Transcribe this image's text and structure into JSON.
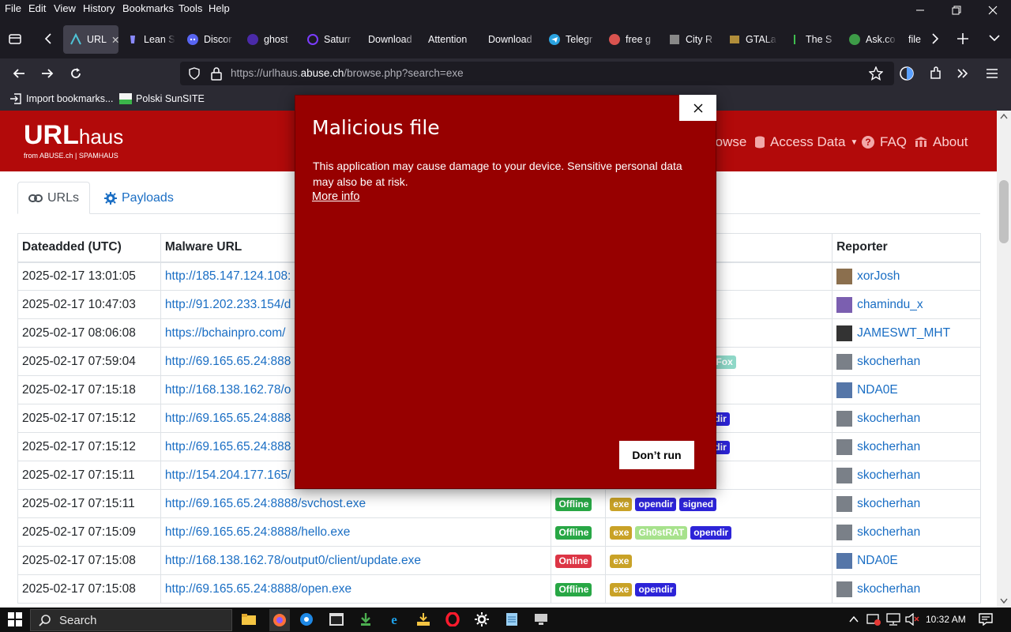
{
  "menu": {
    "items": [
      "File",
      "Edit",
      "View",
      "History",
      "Bookmarks",
      "Tools",
      "Help"
    ]
  },
  "tabs": [
    {
      "label": "URL",
      "active": true
    },
    {
      "label": "Lean S"
    },
    {
      "label": "Discor"
    },
    {
      "label": "ghost"
    },
    {
      "label": "Saturr"
    },
    {
      "label": "Download"
    },
    {
      "label": "Attention"
    },
    {
      "label": "Download"
    },
    {
      "label": "Telegr"
    },
    {
      "label": "free g"
    },
    {
      "label": "City R"
    },
    {
      "label": "GTALa"
    },
    {
      "label": "The S"
    },
    {
      "label": "Ask.co"
    },
    {
      "label": "file"
    }
  ],
  "navbar": {
    "url_prefix": "https://urlhaus.",
    "url_domain": "abuse.ch",
    "url_suffix": "/browse.php?search=exe"
  },
  "bookmarks": {
    "import": "Import bookmarks...",
    "sunsite": "Polski SunSITE"
  },
  "site": {
    "logo_main": "URL",
    "logo_sub": "haus",
    "logo_from": "from ABUSE.ch  |  SPAMHAUS",
    "nav": {
      "browse": "rowse",
      "access": "Access Data",
      "faq": "FAQ",
      "about": "About"
    },
    "tabs": {
      "urls": "URLs",
      "payloads": "Payloads"
    }
  },
  "table": {
    "headers": {
      "date": "Dateadded (UTC)",
      "url": "Malware URL",
      "reporter": "Reporter"
    },
    "rows": [
      {
        "date": "2025-02-17 13:01:05",
        "url": "http://185.147.124.108:",
        "status": "",
        "tags": [],
        "reporter": "xorJosh"
      },
      {
        "date": "2025-02-17 10:47:03",
        "url": "http://91.202.233.154/d",
        "status": "",
        "tags": [],
        "reporter": "chamindu_x"
      },
      {
        "date": "2025-02-17 08:06:08",
        "url": "https://bchainpro.com/",
        "status": "",
        "tags": [],
        "reporter": "JAMESWT_MHT"
      },
      {
        "date": "2025-02-17 07:59:04",
        "url": "http://69.165.65.24:888",
        "status": "",
        "tags": [
          "Fox"
        ],
        "reporter": "skocherhan"
      },
      {
        "date": "2025-02-17 07:15:18",
        "url": "http://168.138.162.78/o",
        "status": "",
        "tags": [],
        "reporter": "NDA0E"
      },
      {
        "date": "2025-02-17 07:15:12",
        "url": "http://69.165.65.24:888",
        "status": "",
        "tags": [
          "dir"
        ],
        "reporter": "skocherhan"
      },
      {
        "date": "2025-02-17 07:15:12",
        "url": "http://69.165.65.24:888",
        "status": "",
        "tags": [
          "dir"
        ],
        "reporter": "skocherhan"
      },
      {
        "date": "2025-02-17 07:15:11",
        "url": "http://154.204.177.165/",
        "status": "",
        "tags": [],
        "reporter": "skocherhan"
      },
      {
        "date": "2025-02-17 07:15:11",
        "url": "http://69.165.65.24:8888/svchost.exe",
        "status": "Offline",
        "tags": [
          "exe",
          "opendir",
          "signed"
        ],
        "reporter": "skocherhan"
      },
      {
        "date": "2025-02-17 07:15:09",
        "url": "http://69.165.65.24:8888/hello.exe",
        "status": "Offline",
        "tags": [
          "exe",
          "Gh0stRAT",
          "opendir"
        ],
        "reporter": "skocherhan"
      },
      {
        "date": "2025-02-17 07:15:08",
        "url": "http://168.138.162.78/output0/client/update.exe",
        "status": "Online",
        "tags": [
          "exe"
        ],
        "reporter": "NDA0E"
      },
      {
        "date": "2025-02-17 07:15:08",
        "url": "http://69.165.65.24:8888/open.exe",
        "status": "Offline",
        "tags": [
          "exe",
          "opendir"
        ],
        "reporter": "skocherhan"
      }
    ]
  },
  "dialog": {
    "title": "Malicious file",
    "message": "This application may cause damage to your device. Sensitive personal data may also be at risk.",
    "more_info": "More info",
    "button": "Don’t run"
  },
  "taskbar": {
    "search": "Search",
    "time": "10:32 AM"
  },
  "colors": {
    "brand_red": "#b20a0a",
    "dialog_red": "#970000",
    "link": "#1a6ec4"
  }
}
